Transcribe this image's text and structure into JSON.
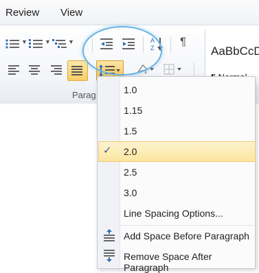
{
  "menubar": {
    "items": [
      "Review",
      "View"
    ]
  },
  "ribbon": {
    "group_label": "Parag",
    "styles": {
      "sample": "AaBbCcDc",
      "name": "¶ Normal"
    },
    "pilcrow": "¶",
    "sort_label": "AZ"
  },
  "line_spacing_menu": {
    "options": [
      "1.0",
      "1.15",
      "1.5",
      "2.0",
      "2.5",
      "3.0"
    ],
    "selected": "2.0",
    "check": "✓",
    "more_options": "Line Spacing Options...",
    "add_space_before": "Add Space Before Paragraph",
    "remove_space_after": "Remove Space After Paragraph"
  },
  "colors": {
    "accent_highlight": "#fbe6a0",
    "ring": "#67b3e3",
    "check": "#3b5a8a"
  }
}
